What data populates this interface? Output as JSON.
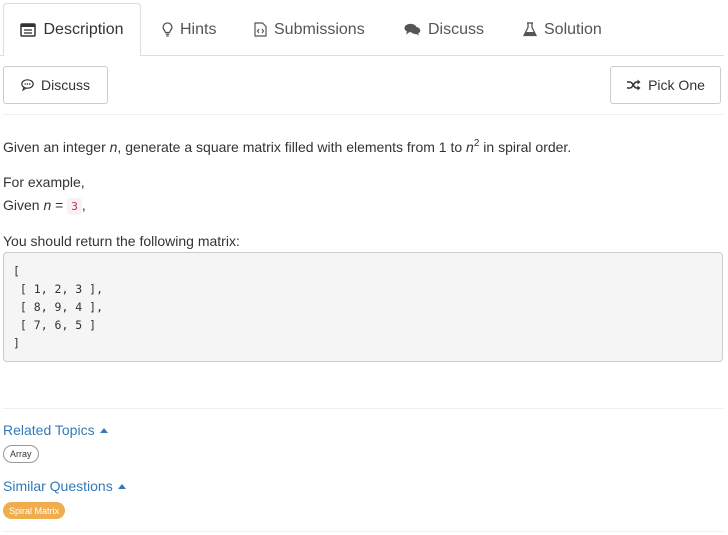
{
  "tabs": [
    {
      "label": "Description",
      "icon": "document-icon",
      "active": true
    },
    {
      "label": "Hints",
      "icon": "lightbulb-icon"
    },
    {
      "label": "Submissions",
      "icon": "code-file-icon"
    },
    {
      "label": "Discuss",
      "icon": "comments-icon"
    },
    {
      "label": "Solution",
      "icon": "flask-icon"
    }
  ],
  "actions": {
    "discuss_label": "Discuss",
    "pick_one_label": "Pick One"
  },
  "problem": {
    "intro_pre": "Given an integer ",
    "intro_var": "n",
    "intro_mid": ", generate a square matrix filled with elements from 1 to ",
    "intro_var2": "n",
    "intro_sup": "2",
    "intro_post": " in spiral order.",
    "for_example": "For example,",
    "given_pre": "Given ",
    "given_var": "n",
    "given_eq": " = ",
    "given_value": "3",
    "given_post": ",",
    "return_text": "You should return the following matrix:",
    "matrix_text": "[\n [ 1, 2, 3 ],\n [ 8, 9, 4 ],\n [ 7, 6, 5 ]\n]"
  },
  "related_topics": {
    "label": "Related Topics",
    "items": [
      "Array"
    ]
  },
  "similar_questions": {
    "label": "Similar Questions",
    "items": [
      "Spiral Matrix"
    ],
    "chip_color": "#f0ad4e"
  },
  "colors": {
    "link": "#337ab7",
    "inline_code": "#c7254e"
  }
}
